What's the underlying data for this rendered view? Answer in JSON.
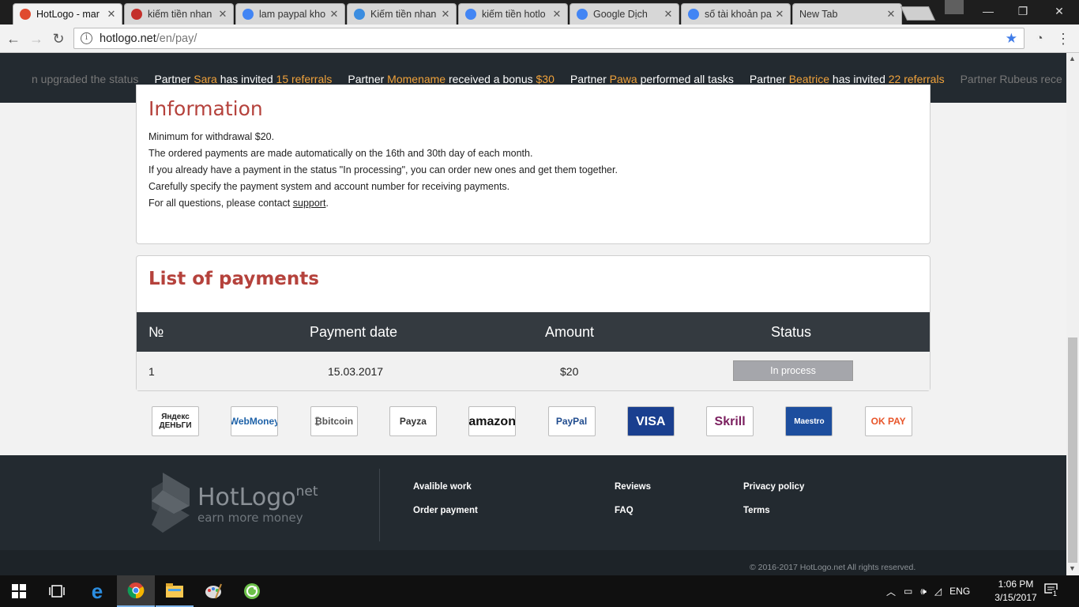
{
  "browser": {
    "tabs": [
      {
        "label": "HotLogo - mar",
        "favicon_color": "#e04a2f",
        "active": true
      },
      {
        "label": "kiếm tiền nhan",
        "favicon_color": "#c4302b",
        "active": false
      },
      {
        "label": "lam paypal kho",
        "favicon_color": "#4285f4",
        "active": false
      },
      {
        "label": "Kiếm tiền nhan",
        "favicon_color": "#3b8de0",
        "active": false
      },
      {
        "label": "kiếm tiền hotlo",
        "favicon_color": "#4285f4",
        "active": false
      },
      {
        "label": "Google Dịch",
        "favicon_color": "#4285f4",
        "active": false
      },
      {
        "label": "số tài khoản pa",
        "favicon_color": "#4285f4",
        "active": false
      },
      {
        "label": "New Tab",
        "favicon_color": "",
        "active": false
      }
    ],
    "url_host": "hotlogo.net",
    "url_path": "/en/pay/"
  },
  "ticker": {
    "items": [
      {
        "prefix": "",
        "name": "",
        "middle": "n upgraded the status",
        "suffix": "",
        "faded": true
      },
      {
        "prefix": "Partner ",
        "name": "Sara",
        "middle": " has invited ",
        "suffix": "15 referrals",
        "faded": false
      },
      {
        "prefix": "Partner ",
        "name": "Momename",
        "middle": " received a bonus ",
        "suffix": "$30",
        "faded": false
      },
      {
        "prefix": "Partner ",
        "name": "Pawa",
        "middle": " performed all tasks",
        "suffix": "",
        "faded": false
      },
      {
        "prefix": "Partner ",
        "name": "Beatrice",
        "middle": " has invited ",
        "suffix": "22 referrals",
        "faded": false
      },
      {
        "prefix": "Partner ",
        "name": "Rubeus",
        "middle": " rece",
        "suffix": "",
        "faded": true
      }
    ]
  },
  "information": {
    "title": "Information",
    "lines": [
      "Minimum for withdrawal $20.",
      "The ordered payments are made automatically on the 16th and 30th day of each month.",
      "If you already have a payment in the status \"In processing\", you can order new ones and get them together.",
      "Carefully specify the payment system and account number for receiving payments."
    ],
    "contact_prefix": "For all questions, please contact ",
    "contact_link": "support",
    "contact_suffix": "."
  },
  "payments": {
    "title": "List of payments",
    "headers": {
      "no": "№",
      "date": "Payment date",
      "amount": "Amount",
      "status": "Status"
    },
    "rows": [
      {
        "no": "1",
        "date": "15.03.2017",
        "amount": "$20",
        "status": "In process"
      }
    ]
  },
  "payment_systems": [
    {
      "name": "Яндекс Деньги",
      "label": "Яндекс\nДЕНЬГИ",
      "color": "#222222",
      "bg": "#ffffff"
    },
    {
      "name": "WebMoney",
      "label": "WebMoney",
      "color": "#1e62a8",
      "bg": "#ffffff"
    },
    {
      "name": "bitcoin",
      "label": "₿bitcoin",
      "color": "#555555",
      "bg": "#ffffff"
    },
    {
      "name": "Payza",
      "label": "Payza",
      "color": "#333333",
      "bg": "#ffffff"
    },
    {
      "name": "amazon",
      "label": "amazon",
      "color": "#111111",
      "bg": "#ffffff"
    },
    {
      "name": "PayPal",
      "label": "PayPal",
      "color": "#1f4b8e",
      "bg": "#ffffff"
    },
    {
      "name": "VISA Electron",
      "label": "VISA",
      "color": "#ffffff",
      "bg": "#1a3f8f"
    },
    {
      "name": "Skrill",
      "label": "Skrill",
      "color": "#7a1e5e",
      "bg": "#ffffff"
    },
    {
      "name": "Maestro",
      "label": "Maestro",
      "color": "#ffffff",
      "bg": "#1d4e9e"
    },
    {
      "name": "OKPAY",
      "label": "OK PAY",
      "color": "#e8552a",
      "bg": "#ffffff"
    }
  ],
  "footer": {
    "brand": "HotLogo",
    "brand_suffix": "net",
    "tagline": "earn more money",
    "links": {
      "available_work": "Avalible work",
      "order_payment": "Order payment",
      "reviews": "Reviews",
      "faq": "FAQ",
      "privacy": "Privacy policy",
      "terms": "Terms"
    },
    "copyright": "© 2016-2017 HotLogo.net All rights reserved."
  },
  "taskbar": {
    "language": "ENG",
    "time": "1:06 PM",
    "date": "3/15/2017",
    "notification_count": "1"
  },
  "colors": {
    "accent_red": "#b5423c",
    "ticker_highlight": "#f0a23b",
    "dark_bg": "#232a30"
  }
}
